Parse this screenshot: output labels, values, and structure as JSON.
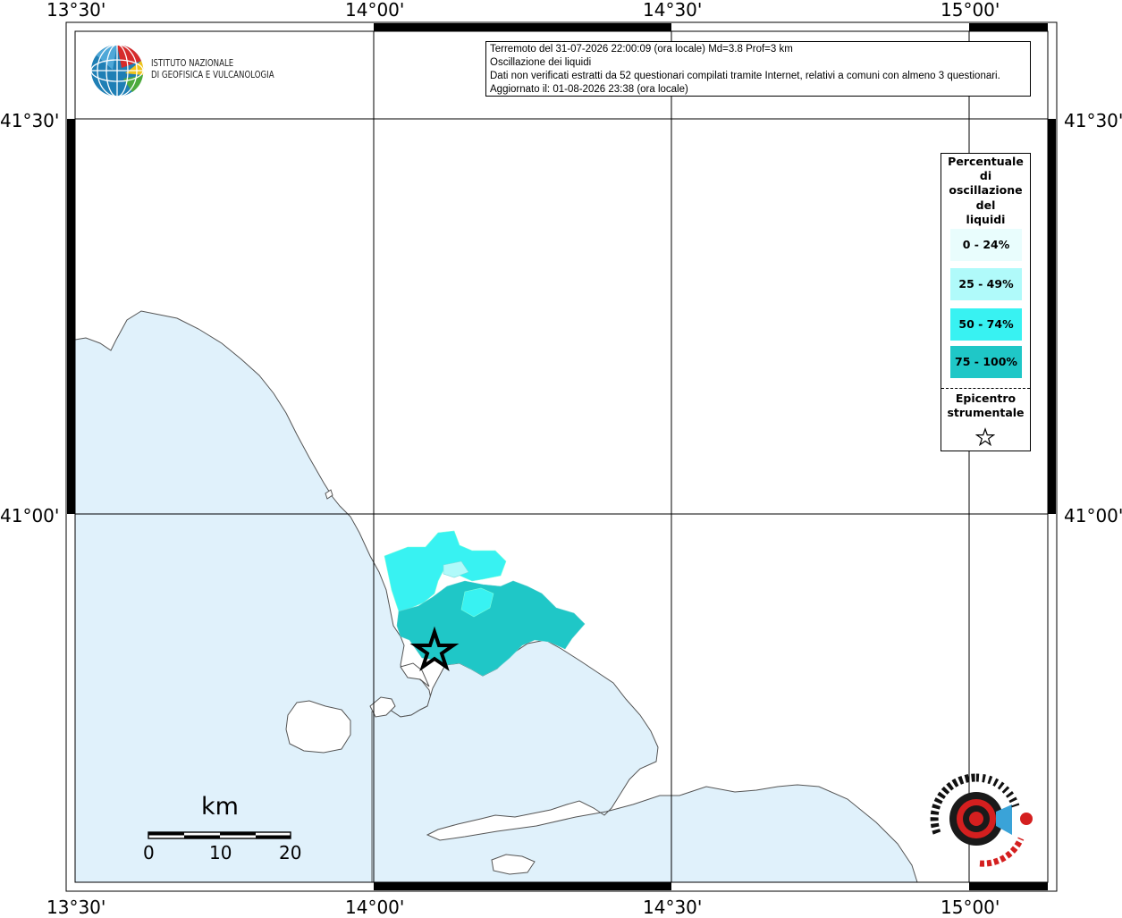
{
  "map": {
    "lon_ticks": [
      "13°30'",
      "14°00'",
      "14°30'",
      "15°00'"
    ],
    "lat_ticks": [
      "41°30'",
      "41°00'"
    ],
    "sea_color": "#e0f1fb",
    "land_color": "#ffffff"
  },
  "logo": {
    "line1": "ISTITUTO NAZIONALE",
    "line2": "DI GEOFISICA E VULCANOLOGIA"
  },
  "info": {
    "line1": "Terremoto del 31-07-2026 22:00:09 (ora locale) Md=3.8 Prof=3 km",
    "line2": "Oscillazione dei liquidi",
    "line3": "Dati non verificati estratti da 52 questionari compilati tramite Internet, relativi a comuni con almeno 3 questionari.",
    "line4": "Aggiornato il: 01-08-2026 23:38 (ora locale)"
  },
  "legend": {
    "title_lines": [
      "Percentuale",
      "di",
      "oscillazione",
      "del",
      "liquidi"
    ],
    "classes": [
      {
        "label": "0 - 24%",
        "color": "#e9fdfd"
      },
      {
        "label": "25 - 49%",
        "color": "#b0fafa"
      },
      {
        "label": "50 - 74%",
        "color": "#38f2f2"
      },
      {
        "label": "75 - 100%",
        "color": "#1fc7c7"
      }
    ],
    "epicenter_lines": [
      "Epicentro",
      "strumentale"
    ],
    "epicenter_icon": "star-outline-icon"
  },
  "scale": {
    "unit": "km",
    "labels": [
      "0",
      "10",
      "20"
    ]
  },
  "watermark": {
    "logo_icon": "haisentito-terremoto-logo-icon"
  }
}
